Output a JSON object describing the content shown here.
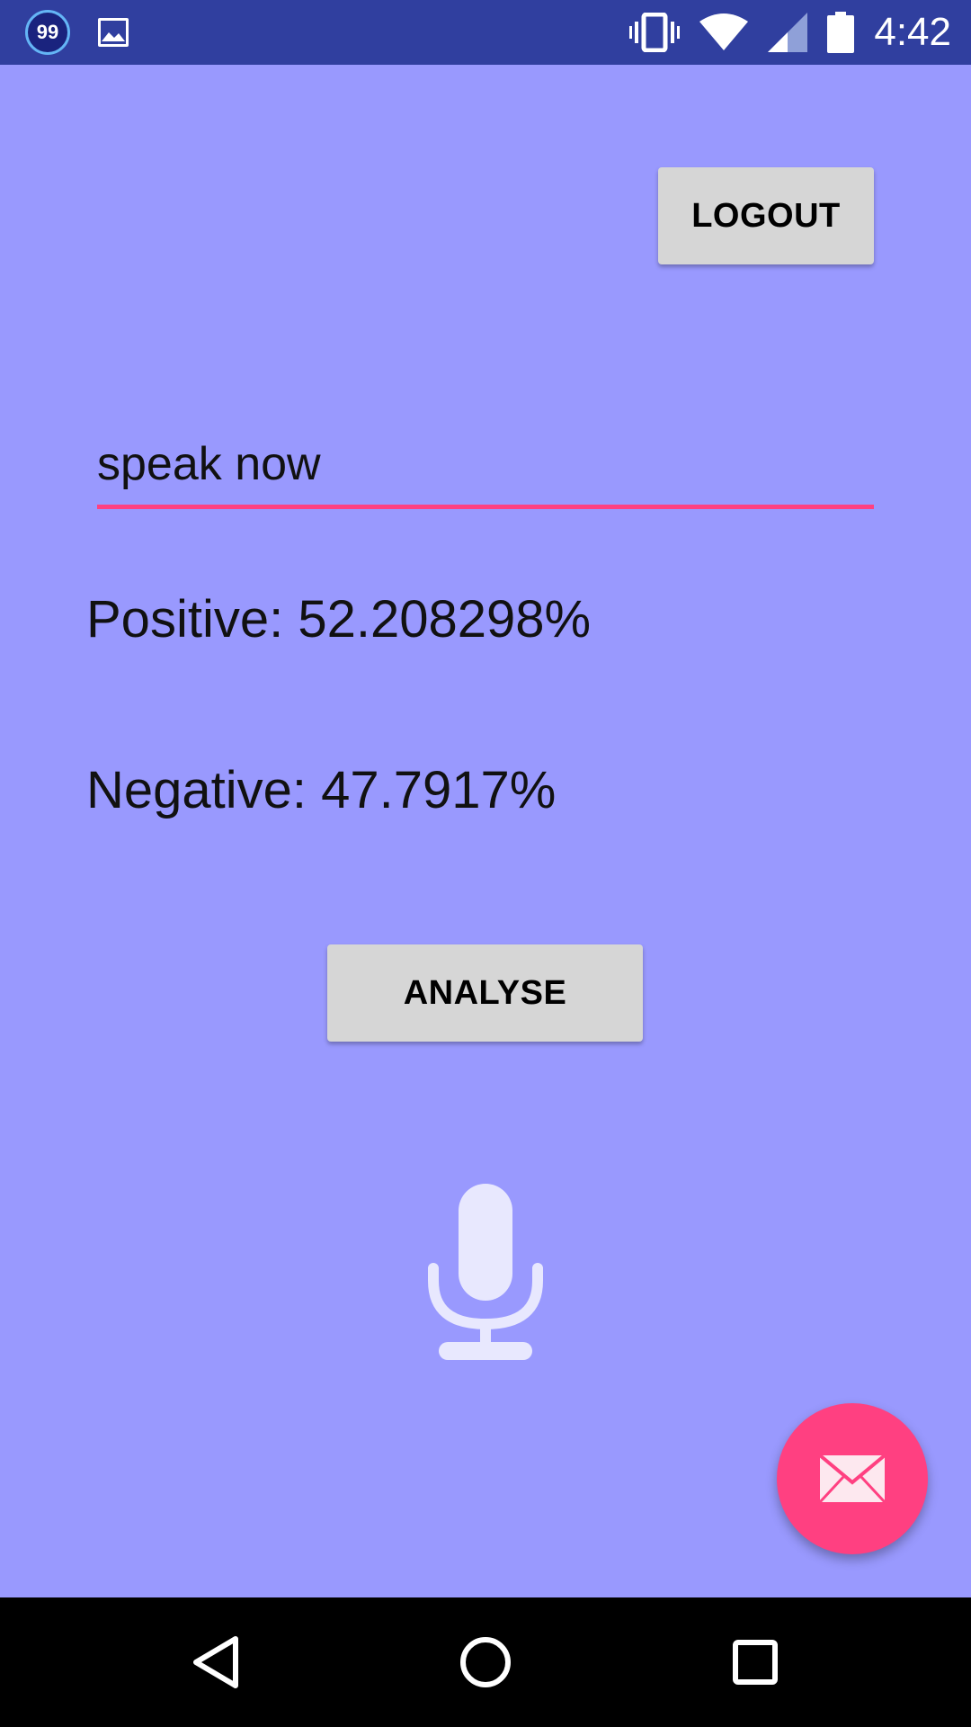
{
  "status_bar": {
    "notification_count": "99",
    "time": "4:42",
    "icons": [
      "notification-badge",
      "image-icon",
      "vibrate-icon",
      "wifi-icon",
      "cell-signal-icon",
      "battery-icon"
    ]
  },
  "header": {
    "logout_label": "LOGOUT"
  },
  "speech": {
    "input_value": "speak now"
  },
  "results": {
    "positive": "Positive: 52.208298%",
    "negative": "Negative: 47.7917%"
  },
  "actions": {
    "analyse_label": "ANALYSE"
  },
  "icons": {
    "mic": "microphone-icon",
    "fab": "mail-icon"
  },
  "colors": {
    "background": "#9999fe",
    "status_bar": "#303f9f",
    "accent": "#ff4081",
    "button": "#d6d6d6"
  },
  "nav_bar": {
    "buttons": [
      "back",
      "home",
      "recents"
    ]
  }
}
